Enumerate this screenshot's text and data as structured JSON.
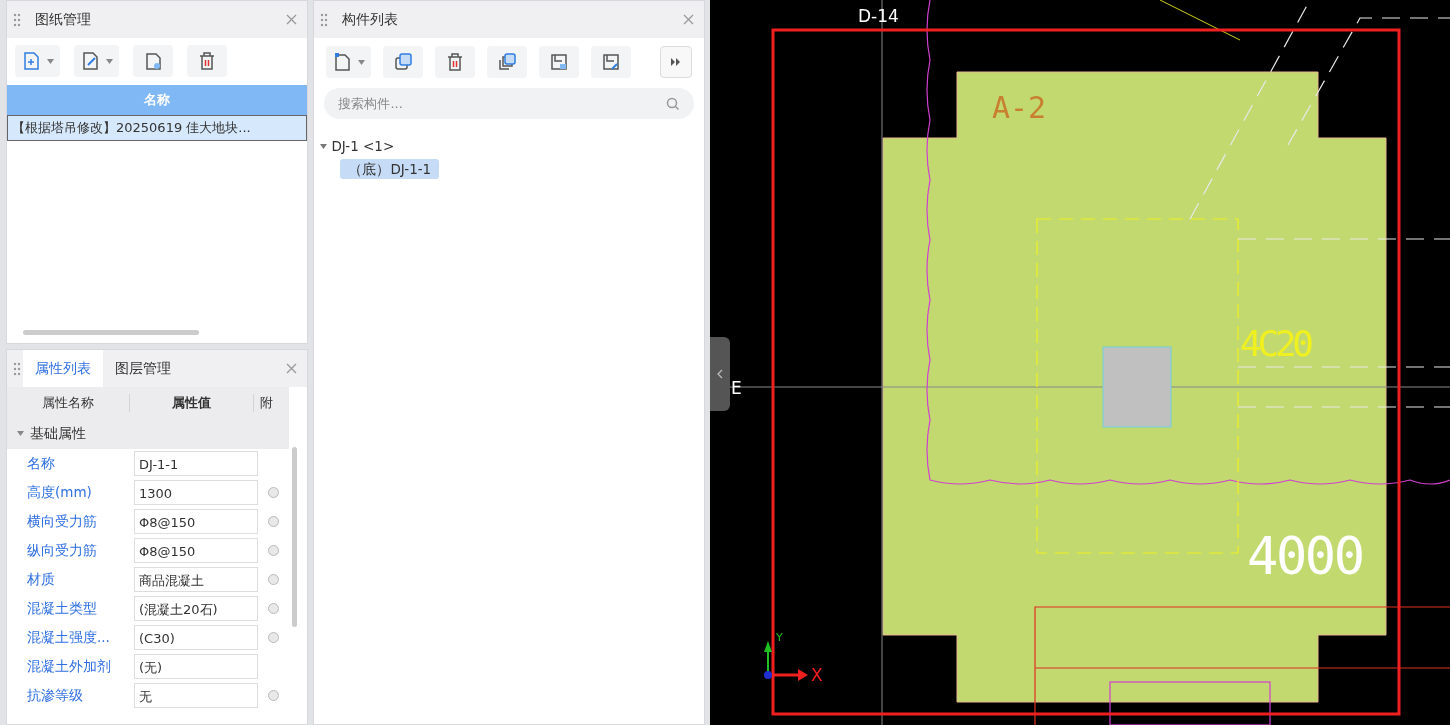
{
  "drawing_panel": {
    "title": "图纸管理",
    "column_header": "名称",
    "rows": [
      {
        "name": "【根据塔吊修改】20250619 佳大地块...",
        "selected": true
      }
    ]
  },
  "property_panel": {
    "tabs": [
      {
        "label": "属性列表",
        "selected": true
      },
      {
        "label": "图层管理",
        "selected": false
      }
    ],
    "columns": [
      "属性名称",
      "属性值",
      "附"
    ],
    "group": {
      "label": "基础属性",
      "expanded": true
    },
    "rows": [
      {
        "kind": "plain",
        "name": "名称",
        "value": "DJ-1-1"
      },
      {
        "kind": "option",
        "name": "高度(mm)",
        "value": "1300",
        "checked": false
      },
      {
        "kind": "option",
        "name": "横向受力筋",
        "value": "Φ8@150",
        "checked": false
      },
      {
        "kind": "option",
        "name": "纵向受力筋",
        "value": "Φ8@150",
        "checked": false
      },
      {
        "kind": "option",
        "name": "材质",
        "value": "商品混凝土",
        "checked": false
      },
      {
        "kind": "option",
        "name": "混凝土类型",
        "value": "(混凝土20石)",
        "checked": false
      },
      {
        "kind": "option",
        "name": "混凝土强度...",
        "value": "(C30)",
        "checked": false
      },
      {
        "kind": "plain",
        "name": "混凝土外加剂",
        "value": "(无)"
      },
      {
        "kind": "option",
        "name": "抗渗等级",
        "value": "无",
        "checked": false
      }
    ]
  },
  "component_panel": {
    "title": "构件列表",
    "search": {
      "placeholder": "搜索构件..."
    },
    "tree": [
      {
        "label": "DJ-1 <1>",
        "expanded": true,
        "selected": false,
        "children": [
          {
            "label": "（底）DJ-1-1",
            "selected": true
          }
        ]
      }
    ]
  },
  "canvas": {
    "axis_labels": [
      "D-14",
      "E"
    ],
    "text_labels": [
      "A-2",
      "4C20",
      "4000"
    ],
    "x_axis": "X",
    "y_axis": "Y"
  }
}
